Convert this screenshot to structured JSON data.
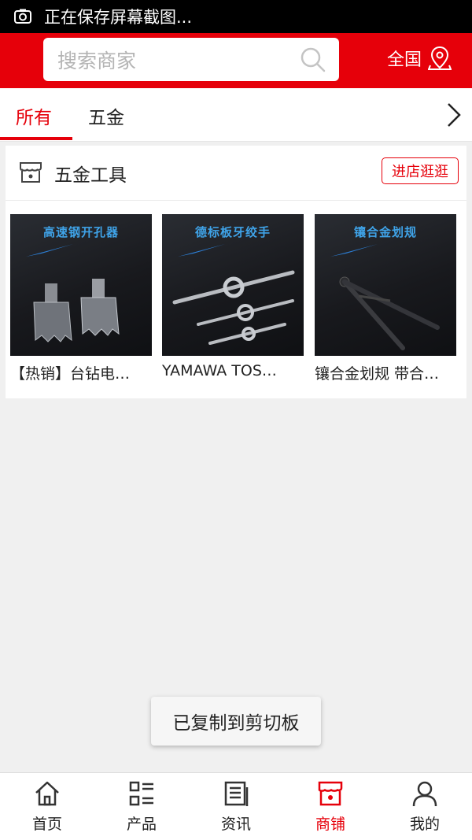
{
  "status_bar": {
    "text": "正在保存屏幕截图..."
  },
  "header": {
    "search_placeholder": "搜索商家",
    "region_label": "全国"
  },
  "tabs": [
    {
      "label": "所有",
      "active": true
    },
    {
      "label": "五金",
      "active": false
    }
  ],
  "store": {
    "name": "五金工具",
    "visit_label": "进店逛逛",
    "products": [
      {
        "title": "【热销】台钻电…",
        "banner": "高速钢开孔器"
      },
      {
        "title": "YAMAWA TOS…",
        "banner": "德标板牙绞手"
      },
      {
        "title": "镶合金划规 带合…",
        "banner": "镶合金划规"
      }
    ]
  },
  "toast": "已复制到剪切板",
  "bottom_nav": [
    {
      "label": "首页",
      "icon": "home-icon",
      "active": false
    },
    {
      "label": "产品",
      "icon": "list-icon",
      "active": false
    },
    {
      "label": "资讯",
      "icon": "news-icon",
      "active": false
    },
    {
      "label": "商铺",
      "icon": "shop-icon",
      "active": true
    },
    {
      "label": "我的",
      "icon": "user-icon",
      "active": false
    }
  ],
  "colors": {
    "accent": "#e6000a",
    "background": "#f0f0f0"
  }
}
